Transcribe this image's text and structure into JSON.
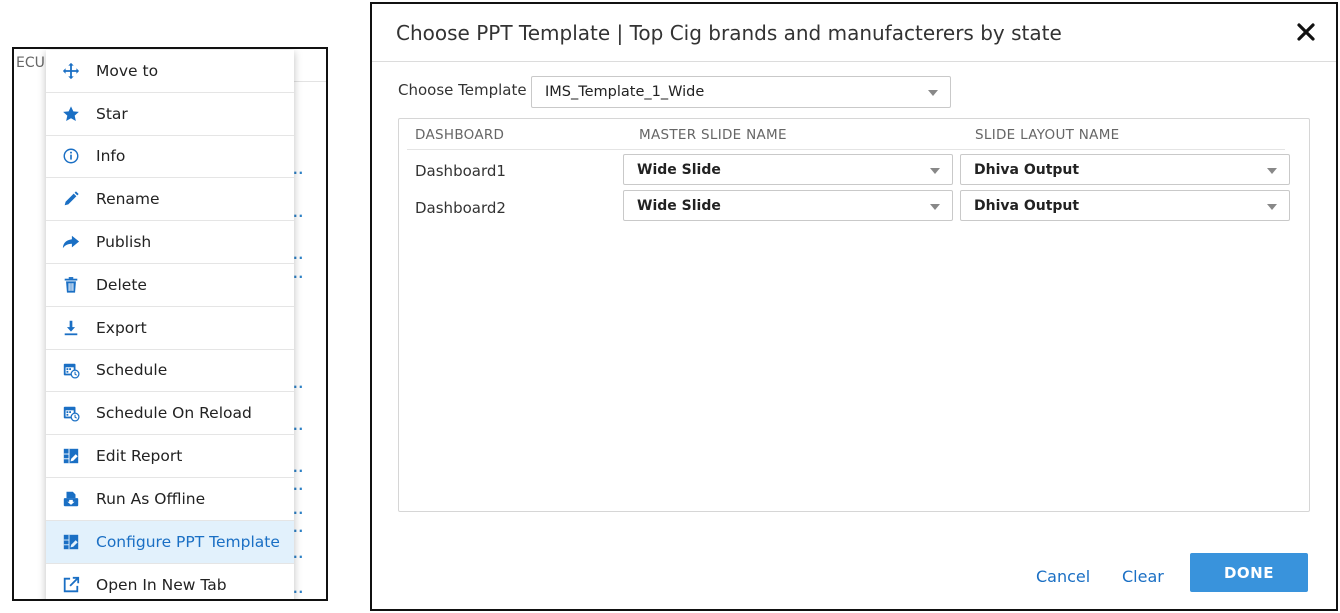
{
  "left_panel": {
    "bg_text": "ECU",
    "menu": {
      "items": [
        {
          "label": "Move to",
          "icon": "move-icon"
        },
        {
          "label": "Star",
          "icon": "star-icon"
        },
        {
          "label": "Info",
          "icon": "info-icon"
        },
        {
          "label": "Rename",
          "icon": "pencil-icon"
        },
        {
          "label": "Publish",
          "icon": "share-icon"
        },
        {
          "label": "Delete",
          "icon": "trash-icon"
        },
        {
          "label": "Export",
          "icon": "download-icon"
        },
        {
          "label": "Schedule",
          "icon": "calendar-clock-icon"
        },
        {
          "label": "Schedule On Reload",
          "icon": "calendar-clock-icon"
        },
        {
          "label": "Edit Report",
          "icon": "table-edit-icon"
        },
        {
          "label": "Run As Offline",
          "icon": "offline-icon"
        },
        {
          "label": "Configure PPT Template",
          "icon": "table-edit-icon",
          "active": true
        },
        {
          "label": "Open In New Tab",
          "icon": "external-link-icon"
        }
      ]
    }
  },
  "dialog": {
    "title": "Choose PPT Template | Top Cig brands and manufacterers by state",
    "choose_template_label": "Choose Template",
    "template_value": "IMS_Template_1_Wide",
    "table": {
      "headers": [
        "DASHBOARD",
        "MASTER SLIDE NAME",
        "SLIDE LAYOUT NAME"
      ],
      "rows": [
        {
          "dashboard": "Dashboard1",
          "master_slide": "Wide Slide",
          "slide_layout": "Dhiva Output"
        },
        {
          "dashboard": "Dashboard2",
          "master_slide": "Wide Slide",
          "slide_layout": "Dhiva Output"
        }
      ]
    },
    "buttons": {
      "cancel": "Cancel",
      "clear": "Clear",
      "done": "DONE"
    }
  },
  "colors": {
    "accent": "#1a6fc4",
    "done_bg": "#3993dc",
    "active_bg": "#e2f1fc"
  }
}
